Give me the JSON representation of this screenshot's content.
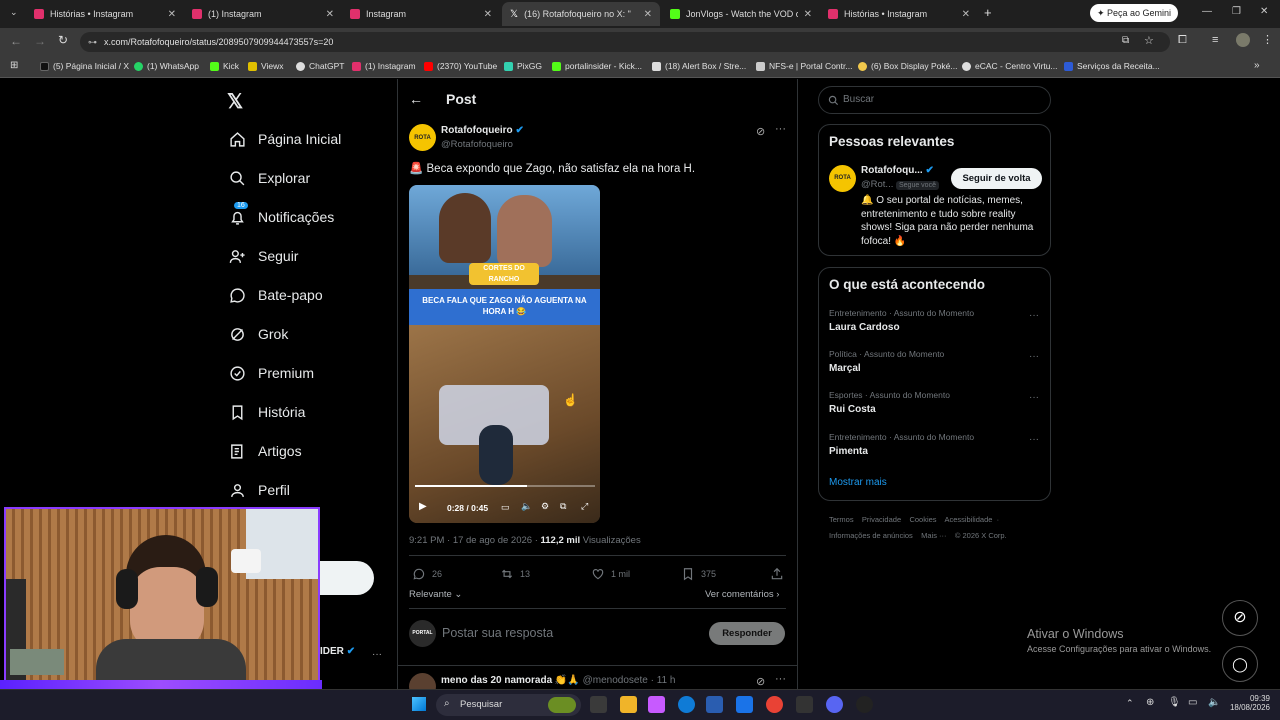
{
  "browser": {
    "tabs": [
      {
        "label": "Histórias • Instagram",
        "color": "#e1306c"
      },
      {
        "label": "(1) Instagram",
        "color": "#e1306c"
      },
      {
        "label": "Instagram",
        "color": "#e1306c"
      },
      {
        "label": "(16) Rotafofoqueiro no X: \"",
        "color": "#000000"
      },
      {
        "label": "JonVlogs - Watch the VOD on",
        "color": "#53fc18"
      },
      {
        "label": "Histórias • Instagram",
        "color": "#e1306c"
      }
    ],
    "gemini_button": "Peça ao Gemini",
    "url": "x.com/Rotafofoqueiro/status/2089507909944473557s=20",
    "bookmarks": [
      "(5) Página Inicial / X",
      "(1) WhatsApp",
      "Kick",
      "Viewx",
      "ChatGPT",
      "(1) Instagram",
      "(2370) YouTube",
      "PixGG",
      "portalinsider - Kick...",
      "(18) Alert Box / Stre...",
      "NFS-e | Portal Contr...",
      "(6) Box Display Poké...",
      "eCAC - Centro Virtu...",
      "Serviços da Receita..."
    ]
  },
  "nav": {
    "items": [
      "Página Inicial",
      "Explorar",
      "Notificações",
      "Seguir",
      "Bate-papo",
      "Grok",
      "Premium",
      "História",
      "Artigos",
      "Perfil"
    ],
    "notif_badge": "16"
  },
  "post": {
    "header": "Post",
    "author_name": "Rotafofoqueiro",
    "author_handle": "@Rotafofoqueiro",
    "text": "🚨 Beca expondo que Zago, não satisfaz ela na hora H.",
    "video_caption_top": "CORTES DO RANCHO",
    "video_caption": "BECA FALA QUE ZAGO NÃO AGUENTA NA HORA H 😂",
    "video_time": "0:28 / 0:45",
    "progress": 0.62,
    "timestamp": "9:21 PM · 17 de ago de 2026 · ",
    "views_count": "112,2 mil",
    "views_label": "Visualizações",
    "replies": "26",
    "reposts": "13",
    "likes": "1 mil",
    "bookmarks": "375",
    "sort": "Relevante",
    "see_comments": "Ver comentários",
    "reply_placeholder": "Postar sua resposta",
    "reply_button": "Responder",
    "next_author": "meno das 20 namorada 👏🙏",
    "next_handle": "@menodosete · 11 h"
  },
  "sidebar": {
    "search_placeholder": "Buscar",
    "relevant_title": "Pessoas relevantes",
    "person_name": "Rotafofoqu...",
    "person_handle": "@Rot...",
    "follows_you": "Segue você",
    "follow_back": "Seguir de volta",
    "person_bio": "🔔 O seu portal de notícias, memes, entretenimento e tudo sobre reality shows! Siga para não perder nenhuma fofoca! 🔥",
    "trending_title": "O que está acontecendo",
    "trends": [
      {
        "category": "Entretenimento · Assunto do Momento",
        "name": "Laura Cardoso"
      },
      {
        "category": "Política · Assunto do Momento",
        "name": "Marçal"
      },
      {
        "category": "Esportes · Assunto do Momento",
        "name": "Rui Costa"
      },
      {
        "category": "Entretenimento · Assunto do Momento",
        "name": "Pimenta"
      }
    ],
    "show_more": "Mostrar mais",
    "footer1": "Termos    Privacidade    Cookies    Acessibilidade  ·",
    "footer2": "Informações de anúncios    Mais ···    © 2026 X Corp."
  },
  "windows": {
    "activate_title": "Ativar o Windows",
    "activate_sub": "Acesse Configurações para ativar o Windows.",
    "search": "Pesquisar",
    "time": "09:39",
    "date": "18/08/2026"
  },
  "stream": {
    "name_fragment": "IDER"
  }
}
